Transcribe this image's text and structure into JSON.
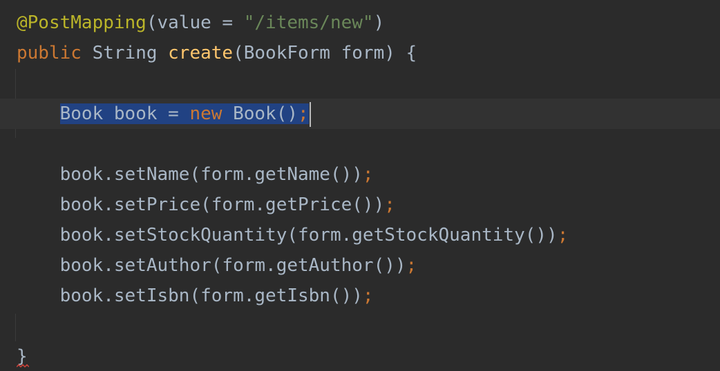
{
  "editor": {
    "colors": {
      "background": "#2b2b2b",
      "current_line": "#323232",
      "selection": "#214283",
      "annotation": "#bbb529",
      "keyword": "#cc7832",
      "string": "#6a8759",
      "method": "#ffc66d",
      "plain": "#a9b7c6"
    },
    "lines": {
      "l1": {
        "annotation": "@PostMapping",
        "open": "(value = ",
        "string": "\"/items/new\"",
        "close": ")"
      },
      "l2": {
        "kw_public": "public",
        "type": " String ",
        "method": "create",
        "params": "(BookForm form) {"
      },
      "l4": {
        "indent": "    ",
        "sel_start": "Book book = ",
        "kw_new": "new",
        "sel_end": " Book()",
        "semi": ";"
      },
      "l6": {
        "indent": "    ",
        "text": "book.setName(form.getName())",
        "semi": ";"
      },
      "l7": {
        "indent": "    ",
        "text": "book.setPrice(form.getPrice())",
        "semi": ";"
      },
      "l8": {
        "indent": "    ",
        "text": "book.setStockQuantity(form.getStockQuantity())",
        "semi": ";"
      },
      "l9": {
        "indent": "    ",
        "text": "book.setAuthor(form.getAuthor())",
        "semi": ";"
      },
      "l10": {
        "indent": "    ",
        "text": "book.setIsbn(form.getIsbn())",
        "semi": ";"
      },
      "l12": {
        "brace": "}"
      }
    },
    "diagnostics": {
      "closing_brace_warning_icon": "squiggle-underline"
    }
  }
}
